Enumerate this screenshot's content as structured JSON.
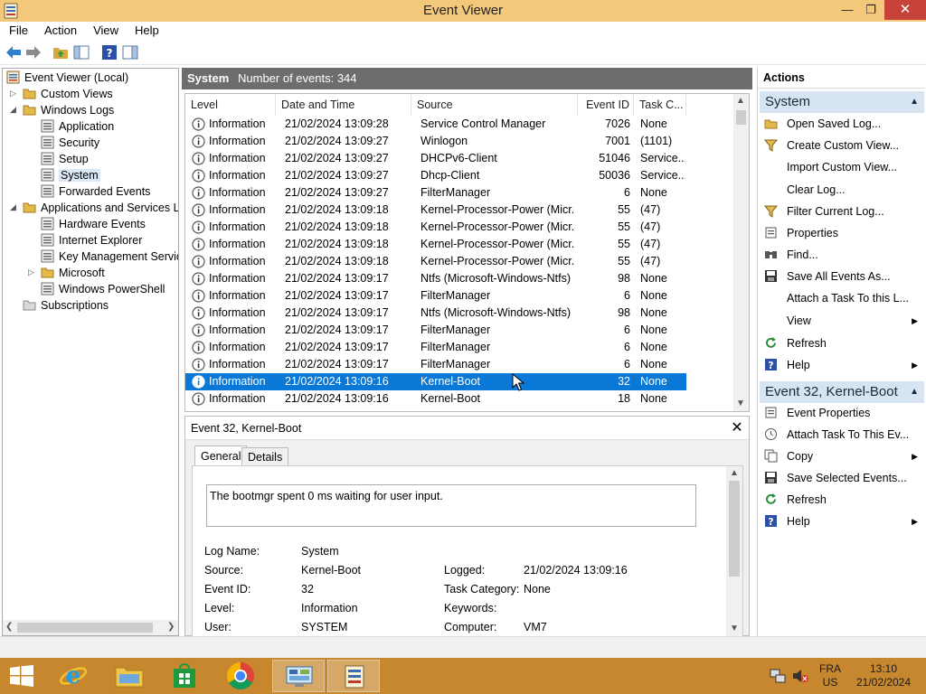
{
  "window": {
    "title": "Event Viewer"
  },
  "menu": [
    "File",
    "Action",
    "View",
    "Help"
  ],
  "tree": [
    {
      "label": "Event Viewer (Local)",
      "level": 0,
      "expander": "",
      "selected": false
    },
    {
      "label": "Custom Views",
      "level": 1,
      "expander": "collapsed",
      "selected": false
    },
    {
      "label": "Windows Logs",
      "level": 1,
      "expander": "expanded",
      "selected": false
    },
    {
      "label": "Application",
      "level": 2,
      "expander": "",
      "selected": false
    },
    {
      "label": "Security",
      "level": 2,
      "expander": "",
      "selected": false
    },
    {
      "label": "Setup",
      "level": 2,
      "expander": "",
      "selected": false
    },
    {
      "label": "System",
      "level": 2,
      "expander": "",
      "selected": true
    },
    {
      "label": "Forwarded Events",
      "level": 2,
      "expander": "",
      "selected": false
    },
    {
      "label": "Applications and Services Logs",
      "level": 1,
      "expander": "expanded",
      "selected": false
    },
    {
      "label": "Hardware Events",
      "level": 2,
      "expander": "",
      "selected": false
    },
    {
      "label": "Internet Explorer",
      "level": 2,
      "expander": "",
      "selected": false
    },
    {
      "label": "Key Management Service",
      "level": 2,
      "expander": "",
      "selected": false
    },
    {
      "label": "Microsoft",
      "level": 2,
      "expander": "collapsed",
      "selected": false
    },
    {
      "label": "Windows PowerShell",
      "level": 2,
      "expander": "",
      "selected": false
    },
    {
      "label": "Subscriptions",
      "level": 1,
      "expander": "",
      "selected": false
    }
  ],
  "center": {
    "log_name": "System",
    "count_text": "Number of events: 344"
  },
  "columns": [
    "Level",
    "Date and Time",
    "Source",
    "Event ID",
    "Task C..."
  ],
  "events": [
    {
      "level": "Information",
      "date": "21/02/2024 13:09:28",
      "source": "Service Control Manager",
      "id": "7026",
      "task": "None",
      "selected": false
    },
    {
      "level": "Information",
      "date": "21/02/2024 13:09:27",
      "source": "Winlogon",
      "id": "7001",
      "task": "(1101)",
      "selected": false
    },
    {
      "level": "Information",
      "date": "21/02/2024 13:09:27",
      "source": "DHCPv6-Client",
      "id": "51046",
      "task": "Service...",
      "selected": false
    },
    {
      "level": "Information",
      "date": "21/02/2024 13:09:27",
      "source": "Dhcp-Client",
      "id": "50036",
      "task": "Service...",
      "selected": false
    },
    {
      "level": "Information",
      "date": "21/02/2024 13:09:27",
      "source": "FilterManager",
      "id": "6",
      "task": "None",
      "selected": false
    },
    {
      "level": "Information",
      "date": "21/02/2024 13:09:18",
      "source": "Kernel-Processor-Power (Micr...",
      "id": "55",
      "task": "(47)",
      "selected": false
    },
    {
      "level": "Information",
      "date": "21/02/2024 13:09:18",
      "source": "Kernel-Processor-Power (Micr...",
      "id": "55",
      "task": "(47)",
      "selected": false
    },
    {
      "level": "Information",
      "date": "21/02/2024 13:09:18",
      "source": "Kernel-Processor-Power (Micr...",
      "id": "55",
      "task": "(47)",
      "selected": false
    },
    {
      "level": "Information",
      "date": "21/02/2024 13:09:18",
      "source": "Kernel-Processor-Power (Micr...",
      "id": "55",
      "task": "(47)",
      "selected": false
    },
    {
      "level": "Information",
      "date": "21/02/2024 13:09:17",
      "source": "Ntfs (Microsoft-Windows-Ntfs)",
      "id": "98",
      "task": "None",
      "selected": false
    },
    {
      "level": "Information",
      "date": "21/02/2024 13:09:17",
      "source": "FilterManager",
      "id": "6",
      "task": "None",
      "selected": false
    },
    {
      "level": "Information",
      "date": "21/02/2024 13:09:17",
      "source": "Ntfs (Microsoft-Windows-Ntfs)",
      "id": "98",
      "task": "None",
      "selected": false
    },
    {
      "level": "Information",
      "date": "21/02/2024 13:09:17",
      "source": "FilterManager",
      "id": "6",
      "task": "None",
      "selected": false
    },
    {
      "level": "Information",
      "date": "21/02/2024 13:09:17",
      "source": "FilterManager",
      "id": "6",
      "task": "None",
      "selected": false
    },
    {
      "level": "Information",
      "date": "21/02/2024 13:09:17",
      "source": "FilterManager",
      "id": "6",
      "task": "None",
      "selected": false
    },
    {
      "level": "Information",
      "date": "21/02/2024 13:09:16",
      "source": "Kernel-Boot",
      "id": "32",
      "task": "None",
      "selected": true
    },
    {
      "level": "Information",
      "date": "21/02/2024 13:09:16",
      "source": "Kernel-Boot",
      "id": "18",
      "task": "None",
      "selected": false
    }
  ],
  "detail": {
    "title": "Event 32, Kernel-Boot",
    "tabs": [
      "General",
      "Details"
    ],
    "description": "The bootmgr spent 0 ms waiting for user input.",
    "log_name_label": "Log Name:",
    "log_name": "System",
    "source_label": "Source:",
    "source": "Kernel-Boot",
    "logged_label": "Logged:",
    "logged": "21/02/2024 13:09:16",
    "event_id_label": "Event ID:",
    "event_id": "32",
    "task_category_label": "Task Category:",
    "task_category": "None",
    "level_label": "Level:",
    "level": "Information",
    "keywords_label": "Keywords:",
    "keywords": "",
    "user_label": "User:",
    "user": "SYSTEM",
    "computer_label": "Computer:",
    "computer": "VM7"
  },
  "actions": {
    "header": "Actions",
    "group1": {
      "title": "System",
      "items": [
        {
          "label": "Open Saved Log...",
          "icon": "open-folder-icon",
          "submenu": false
        },
        {
          "label": "Create Custom View...",
          "icon": "filter-icon",
          "submenu": false
        },
        {
          "label": "Import Custom View...",
          "icon": "",
          "submenu": false
        },
        {
          "label": "Clear Log...",
          "icon": "",
          "submenu": false
        },
        {
          "label": "Filter Current Log...",
          "icon": "filter-icon",
          "submenu": false
        },
        {
          "label": "Properties",
          "icon": "properties-icon",
          "submenu": false
        },
        {
          "label": "Find...",
          "icon": "find-icon",
          "submenu": false
        },
        {
          "label": "Save All Events As...",
          "icon": "save-icon",
          "submenu": false
        },
        {
          "label": "Attach a Task To this L...",
          "icon": "",
          "submenu": false
        },
        {
          "label": "View",
          "icon": "",
          "submenu": true
        },
        {
          "label": "Refresh",
          "icon": "refresh-icon",
          "submenu": false
        },
        {
          "label": "Help",
          "icon": "help-icon",
          "submenu": true
        }
      ]
    },
    "group2": {
      "title": "Event 32, Kernel-Boot",
      "items": [
        {
          "label": "Event Properties",
          "icon": "event-properties-icon",
          "submenu": false
        },
        {
          "label": "Attach Task To This Ev...",
          "icon": "task-icon",
          "submenu": false
        },
        {
          "label": "Copy",
          "icon": "copy-icon",
          "submenu": true
        },
        {
          "label": "Save Selected Events...",
          "icon": "save-icon",
          "submenu": false
        },
        {
          "label": "Refresh",
          "icon": "refresh-icon",
          "submenu": false
        },
        {
          "label": "Help",
          "icon": "help-icon",
          "submenu": true
        }
      ]
    }
  },
  "taskbar": {
    "lang_top": "FRA",
    "lang_bottom": "US",
    "time": "13:10",
    "date": "21/02/2024"
  },
  "colors": {
    "titlebar": "#f4c87a",
    "taskbar": "#c7872f",
    "selection": "#0a78d7",
    "action_group_header": "#d7e4f2"
  }
}
